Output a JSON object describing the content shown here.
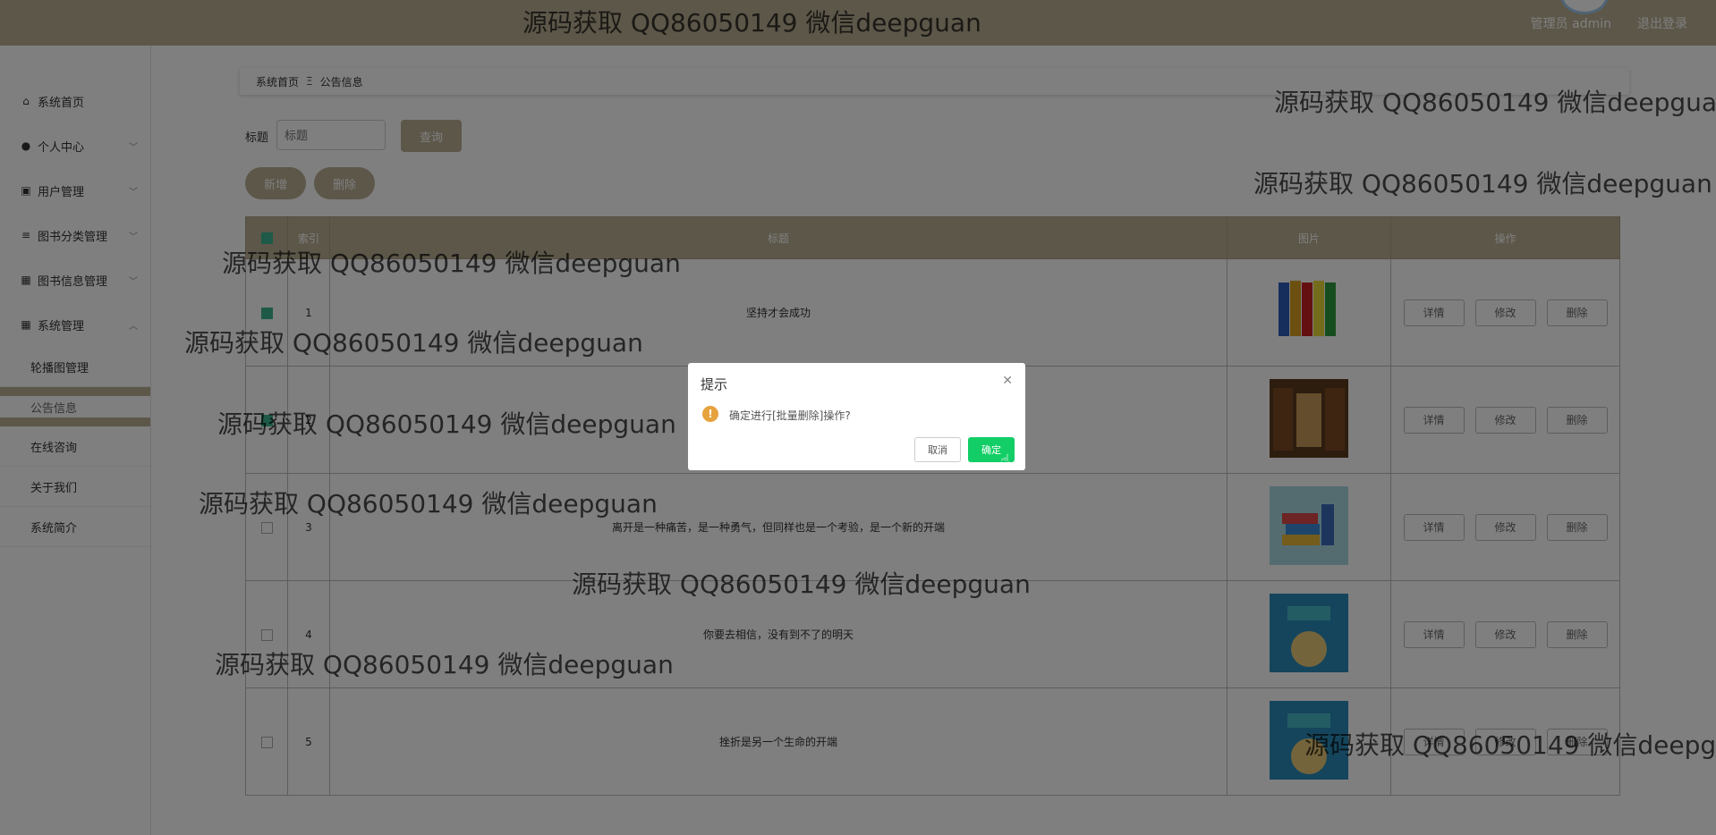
{
  "topbar": {
    "user": "管理员 admin",
    "logout": "退出登录"
  },
  "sidebar": {
    "items": [
      {
        "icon": "home-icon",
        "label": "系统首页"
      },
      {
        "icon": "user-icon",
        "label": "个人中心"
      },
      {
        "icon": "user-admin-icon",
        "label": "用户管理"
      },
      {
        "icon": "list-icon",
        "label": "图书分类管理"
      },
      {
        "icon": "grid-icon",
        "label": "图书信息管理"
      },
      {
        "icon": "grid-icon",
        "label": "系统管理"
      }
    ],
    "sub_items": [
      "轮播图管理",
      "公告信息",
      "在线咨询",
      "关于我们",
      "系统简介"
    ]
  },
  "breadcrumb": {
    "home": "系统首页",
    "current": "公告信息"
  },
  "search": {
    "label": "标题",
    "placeholder": "标题",
    "button": "查询"
  },
  "actions": {
    "add": "新增",
    "delete": "删除"
  },
  "table": {
    "headers": [
      "索引",
      "标题",
      "图片",
      "操作"
    ],
    "rows": [
      {
        "index": "1",
        "title": "坚持才会成功",
        "checked": true
      },
      {
        "index": "2",
        "title": "",
        "checked": true
      },
      {
        "index": "3",
        "title": "离开是一种痛苦，是一种勇气，但同样也是一个考验，是一个新的开端",
        "checked": false
      },
      {
        "index": "4",
        "title": "你要去相信，没有到不了的明天",
        "checked": false
      },
      {
        "index": "5",
        "title": "挫折是另一个生命的开端",
        "checked": false
      }
    ],
    "row_buttons": [
      "详情",
      "修改",
      "删除"
    ]
  },
  "dialog": {
    "title": "提示",
    "message": "确定进行[批量删除]操作?",
    "cancel": "取消",
    "confirm": "确定"
  },
  "watermark_text": "源码获取 QQ86050149 微信deepguan"
}
